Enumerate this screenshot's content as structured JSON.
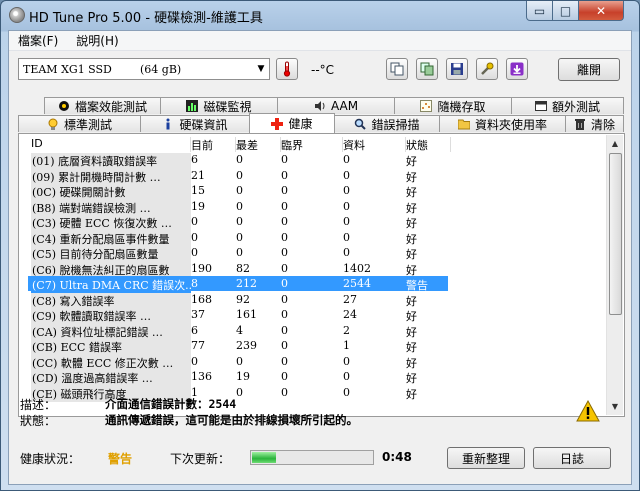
{
  "window": {
    "title": "HD Tune Pro  5.00 - 硬碟檢測-維護工具",
    "min_glyph": "▭",
    "max_glyph": "□",
    "close_glyph": "✕"
  },
  "menu": [
    {
      "label": "檔案(F)"
    },
    {
      "label": "說明(H)"
    }
  ],
  "toolbar": {
    "drive_name": "TEAM XG1 SSD",
    "drive_size": "(64 gB)",
    "temperature": "--°C",
    "exit_label": "離開"
  },
  "tabs": {
    "row1": [
      {
        "label": "檔案效能測試",
        "icon": "file-benchmark-icon"
      },
      {
        "label": "磁碟監視",
        "icon": "disk-monitor-icon"
      },
      {
        "label": "AAM",
        "icon": "speaker-icon"
      },
      {
        "label": "隨機存取",
        "icon": "random-access-icon"
      },
      {
        "label": "額外測試",
        "icon": "extra-tests-icon"
      }
    ],
    "row2": [
      {
        "label": "標準測試",
        "icon": "benchmark-icon"
      },
      {
        "label": "硬碟資訊",
        "icon": "info-icon"
      },
      {
        "label": "健康",
        "icon": "health-cross-icon"
      },
      {
        "label": "錯誤掃描",
        "icon": "magnifier-icon"
      },
      {
        "label": "資料夾使用率",
        "icon": "folder-icon"
      },
      {
        "label": "清除",
        "icon": "trash-icon"
      }
    ]
  },
  "table": {
    "columns": [
      "ID",
      "目前",
      "最差",
      "臨界",
      "資料",
      "狀態"
    ],
    "rows": [
      {
        "id": "(01) 底層資料讀取錯誤率",
        "cur": "6",
        "worst": "0",
        "thr": "0",
        "data": "0",
        "status": "好"
      },
      {
        "id": "(09) 累計開機時間計數    …",
        "cur": "21",
        "worst": "0",
        "thr": "0",
        "data": "0",
        "status": "好"
      },
      {
        "id": "(0C) 硬碟開關計數",
        "cur": "15",
        "worst": "0",
        "thr": "0",
        "data": "0",
        "status": "好"
      },
      {
        "id": "(B8) 端對端錯誤檢測     …",
        "cur": "19",
        "worst": "0",
        "thr": "0",
        "data": "0",
        "status": "好"
      },
      {
        "id": "(C3) 硬體 ECC 恢復次數   …",
        "cur": "0",
        "worst": "0",
        "thr": "0",
        "data": "0",
        "status": "好"
      },
      {
        "id": "(C4) 重新分配扇區事件數量",
        "cur": "0",
        "worst": "0",
        "thr": "0",
        "data": "0",
        "status": "好"
      },
      {
        "id": "(C5) 目前待分配扇區數量",
        "cur": "0",
        "worst": "0",
        "thr": "0",
        "data": "0",
        "status": "好"
      },
      {
        "id": "(C6) 脫機無法糾正的扇區數",
        "cur": "190",
        "worst": "82",
        "thr": "0",
        "data": "1402",
        "status": "好"
      },
      {
        "id": "(C7) Ultra DMA CRC 錯誤次...",
        "cur": "8",
        "worst": "212",
        "thr": "0",
        "data": "2544",
        "status": "警告",
        "selected": true
      },
      {
        "id": "(C8) 寫入錯誤率",
        "cur": "168",
        "worst": "92",
        "thr": "0",
        "data": "27",
        "status": "好"
      },
      {
        "id": "(C9) 軟體讀取錯誤率     …",
        "cur": "37",
        "worst": "161",
        "thr": "0",
        "data": "24",
        "status": "好"
      },
      {
        "id": "(CA) 資料位址標記錯誤   …",
        "cur": "6",
        "worst": "4",
        "thr": "0",
        "data": "2",
        "status": "好"
      },
      {
        "id": "(CB) ECC 錯誤率",
        "cur": "77",
        "worst": "239",
        "thr": "0",
        "data": "1",
        "status": "好"
      },
      {
        "id": "(CC) 軟體 ECC 修正次數   …",
        "cur": "0",
        "worst": "0",
        "thr": "0",
        "data": "0",
        "status": "好"
      },
      {
        "id": "(CD) 溫度過高錯誤率     …",
        "cur": "136",
        "worst": "19",
        "thr": "0",
        "data": "0",
        "status": "好"
      },
      {
        "id": "(CE) 磁頭飛行高度",
        "cur": "1",
        "worst": "0",
        "thr": "0",
        "data": "0",
        "status": "好"
      }
    ]
  },
  "details": {
    "desc_label": "描述：",
    "desc_value": "介面通信錯誤計數：2544",
    "status_label": "狀態：",
    "status_value": "通訊傳遞錯誤，這可能是由於排線損壞所引起的。"
  },
  "footer": {
    "health_label": "健康狀況：",
    "health_value": "警告",
    "next_update_label": "下次更新：",
    "progress": 0.2,
    "timer": "0:48",
    "refresh_label": "重新整理",
    "log_label": "日誌"
  },
  "colors": {
    "selection": "#3399ff",
    "warning": "#e0a000"
  }
}
